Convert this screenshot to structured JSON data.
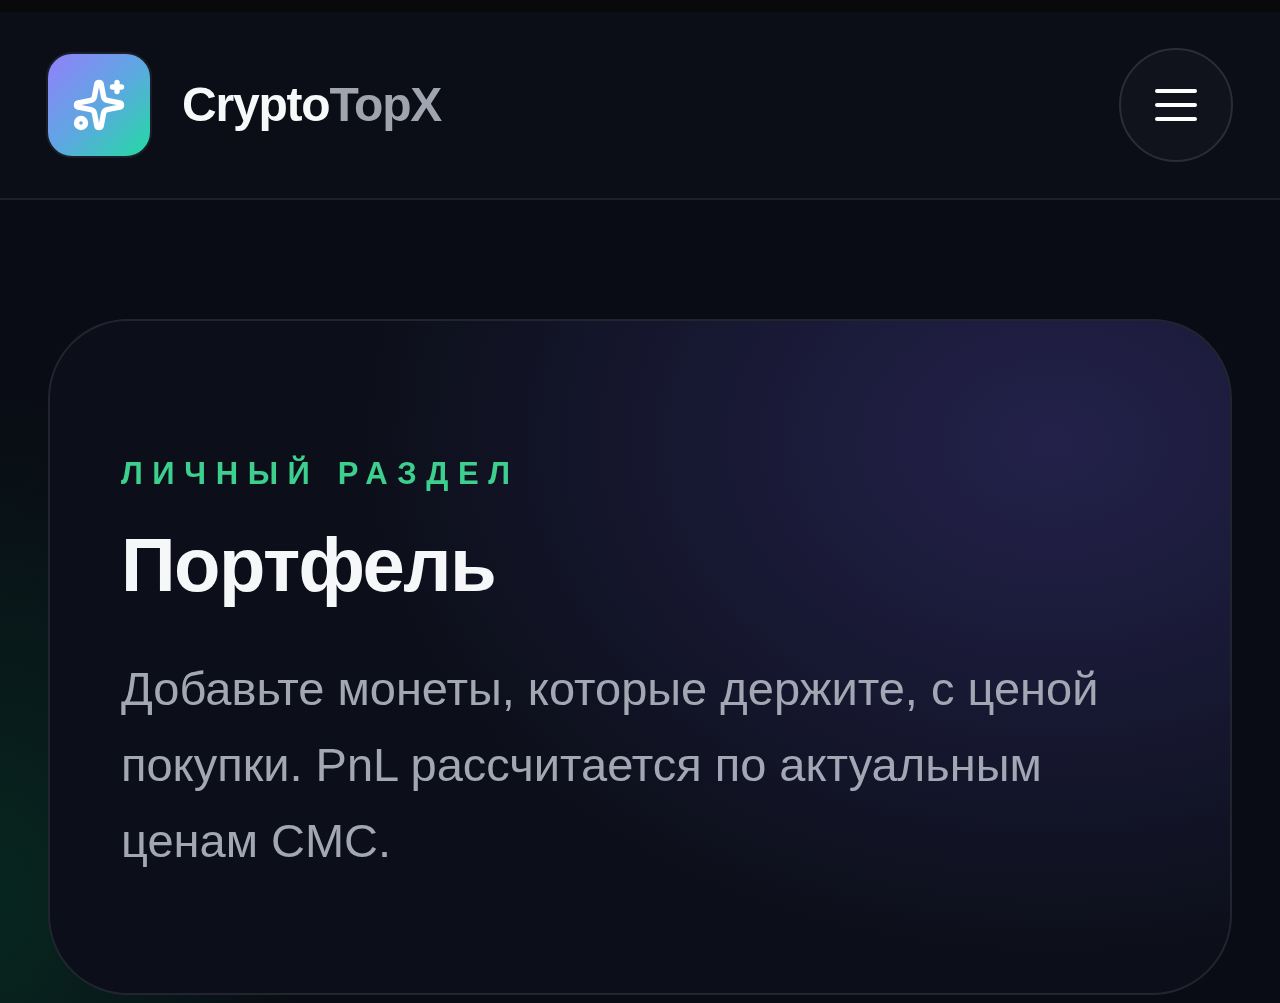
{
  "header": {
    "brand": {
      "primary": "Crypto",
      "secondary": "TopX"
    }
  },
  "hero_card": {
    "eyebrow": "ЛИЧНЫЙ РАЗДЕЛ",
    "title": "Портфель",
    "description": "Добавьте монеты, которые держите, с ценой покупки. PnL рассчитается по актуальным ценам CMC."
  }
}
